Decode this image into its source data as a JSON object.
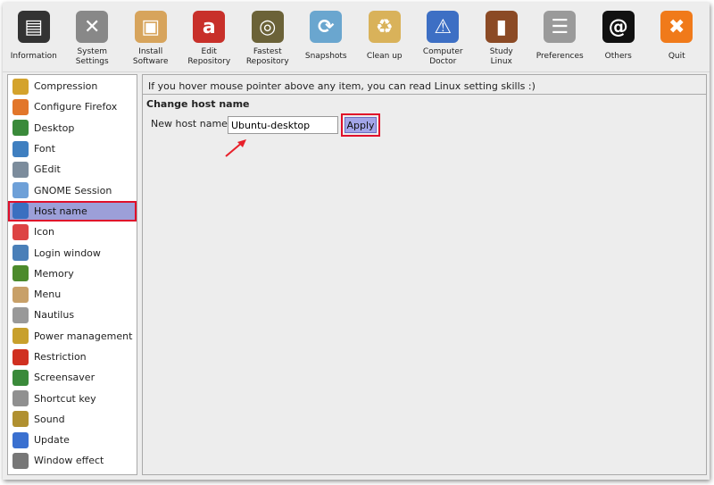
{
  "toolbar": [
    {
      "label": "Information",
      "icon": "information-icon",
      "color": "#333333"
    },
    {
      "label": "System\nSettings",
      "icon": "tools-icon",
      "color": "#888888"
    },
    {
      "label": "Install\nSoftware",
      "icon": "package-icon",
      "color": "#d7a45c"
    },
    {
      "label": "Edit\nRepository",
      "icon": "edit-repository-icon",
      "color": "#c8302a"
    },
    {
      "label": "Fastest\nRepository",
      "icon": "radar-icon",
      "color": "#6b6238"
    },
    {
      "label": "Snapshots",
      "icon": "refresh-icon",
      "color": "#6aa6cf"
    },
    {
      "label": "Clean up",
      "icon": "trash-icon",
      "color": "#d9b25a"
    },
    {
      "label": "Computer\nDoctor",
      "icon": "warning-icon",
      "color": "#3d6fc4"
    },
    {
      "label": "Study\nLinux",
      "icon": "book-icon",
      "color": "#8b4a25"
    },
    {
      "label": "Preferences",
      "icon": "sliders-icon",
      "color": "#9a9a9a"
    },
    {
      "label": "Others",
      "icon": "others-icon",
      "color": "#111111"
    },
    {
      "label": "Quit",
      "icon": "close-icon",
      "color": "#f07a1a"
    }
  ],
  "sidebar": {
    "selected": "Host name",
    "items": [
      {
        "label": "Compression",
        "color": "#d4a32c"
      },
      {
        "label": "Configure Firefox",
        "color": "#e2762a"
      },
      {
        "label": "Desktop",
        "color": "#3a8a3a"
      },
      {
        "label": "Font",
        "color": "#3f7fc0"
      },
      {
        "label": "GEdit",
        "color": "#7c8c9c"
      },
      {
        "label": "GNOME Session",
        "color": "#6ea0d8"
      },
      {
        "label": "Host name",
        "color": "#3a6fc0"
      },
      {
        "label": "Icon",
        "color": "#d44"
      },
      {
        "label": "Login window",
        "color": "#4a7fb8"
      },
      {
        "label": "Memory",
        "color": "#4c8a2c"
      },
      {
        "label": "Menu",
        "color": "#c8a068"
      },
      {
        "label": "Nautilus",
        "color": "#999999"
      },
      {
        "label": "Power management",
        "color": "#c8a02c"
      },
      {
        "label": "Restriction",
        "color": "#d03020"
      },
      {
        "label": "Screensaver",
        "color": "#3a8a3a"
      },
      {
        "label": "Shortcut key",
        "color": "#909090"
      },
      {
        "label": "Sound",
        "color": "#b09030"
      },
      {
        "label": "Update",
        "color": "#3a70d0"
      },
      {
        "label": "Window effect",
        "color": "#777777"
      }
    ]
  },
  "main": {
    "hint": "If you hover mouse pointer above any item, you can read Linux setting skills :)",
    "section_title": "Change host name",
    "field_label": "New host name:",
    "field_value": "Ubuntu-desktop",
    "apply_label": "Apply"
  },
  "colors": {
    "highlight": "#e0102a",
    "selection": "#9c9fd8"
  }
}
